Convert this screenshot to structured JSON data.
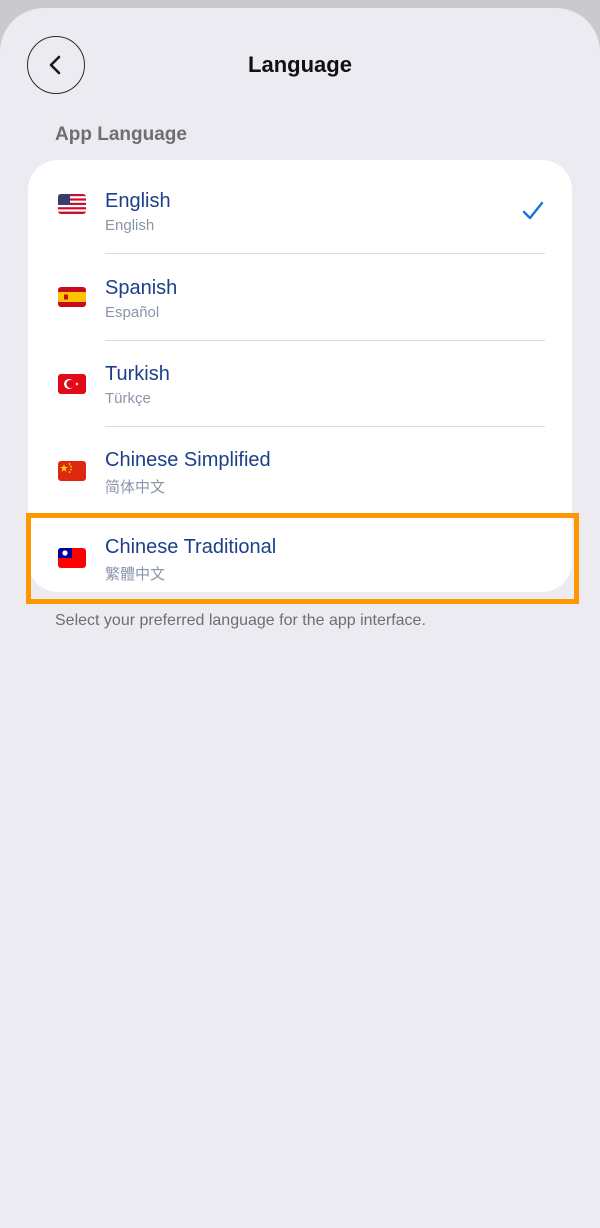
{
  "header": {
    "title": "Language",
    "back_icon": "chevron-left-icon"
  },
  "section": {
    "label": "App Language"
  },
  "languages": [
    {
      "name": "English",
      "native": "English",
      "flag": "us-flag-icon",
      "selected": true
    },
    {
      "name": "Spanish",
      "native": "Español",
      "flag": "spain-flag-icon",
      "selected": false
    },
    {
      "name": "Turkish",
      "native": "Türkçe",
      "flag": "turkey-flag-icon",
      "selected": false
    },
    {
      "name": "Chinese Simplified",
      "native": "简体中文",
      "flag": "china-flag-icon",
      "selected": false
    },
    {
      "name": "Chinese Traditional",
      "native": "繁體中文",
      "flag": "taiwan-flag-icon",
      "selected": false
    }
  ],
  "footer": {
    "note": "Select your preferred language for the app interface."
  },
  "colors": {
    "accent": "#1d6fe0",
    "highlight": "#ff9800",
    "background": "#ebebf1",
    "text_primary": "#1d3f8a",
    "text_secondary": "#8a95aa"
  }
}
